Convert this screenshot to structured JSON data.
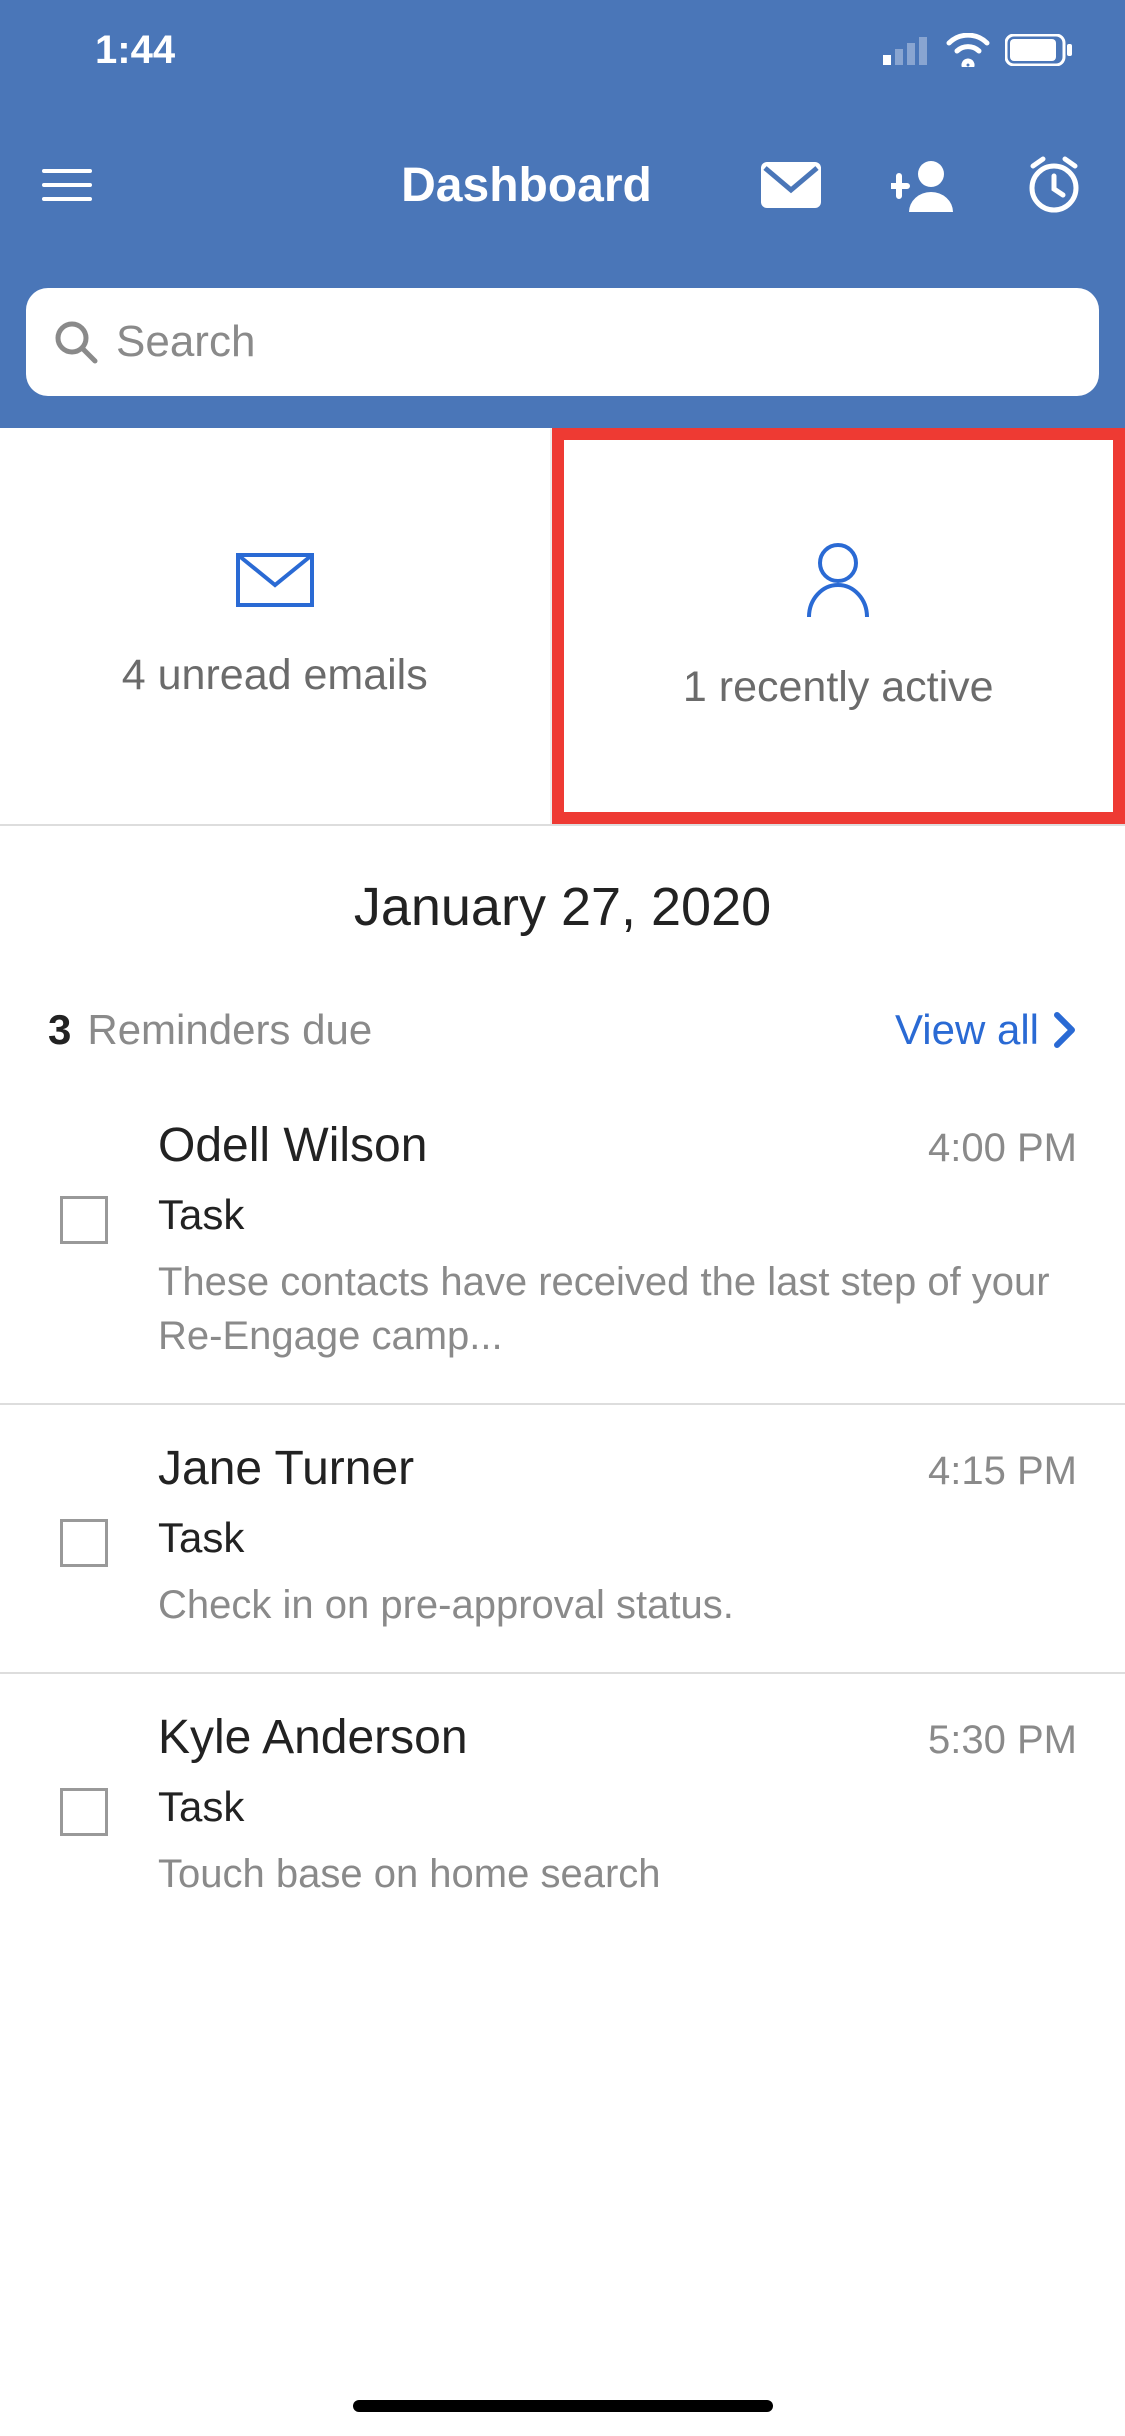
{
  "status": {
    "time": "1:44"
  },
  "header": {
    "title": "Dashboard"
  },
  "search": {
    "placeholder": "Search"
  },
  "cards": {
    "emails": {
      "label": "4 unread emails"
    },
    "active": {
      "label": "1 recently active"
    }
  },
  "date": "January 27, 2020",
  "reminders": {
    "count": "3",
    "label": "Reminders due",
    "viewAll": "View all",
    "items": [
      {
        "name": "Odell Wilson",
        "time": "4:00 PM",
        "type": "Task",
        "desc": "These contacts have received the last step of your Re-Engage camp..."
      },
      {
        "name": "Jane Turner",
        "time": "4:15 PM",
        "type": "Task",
        "desc": "Check in on pre-approval status."
      },
      {
        "name": "Kyle Anderson",
        "time": "5:30 PM",
        "type": "Task",
        "desc": "Touch base on home search"
      }
    ]
  }
}
